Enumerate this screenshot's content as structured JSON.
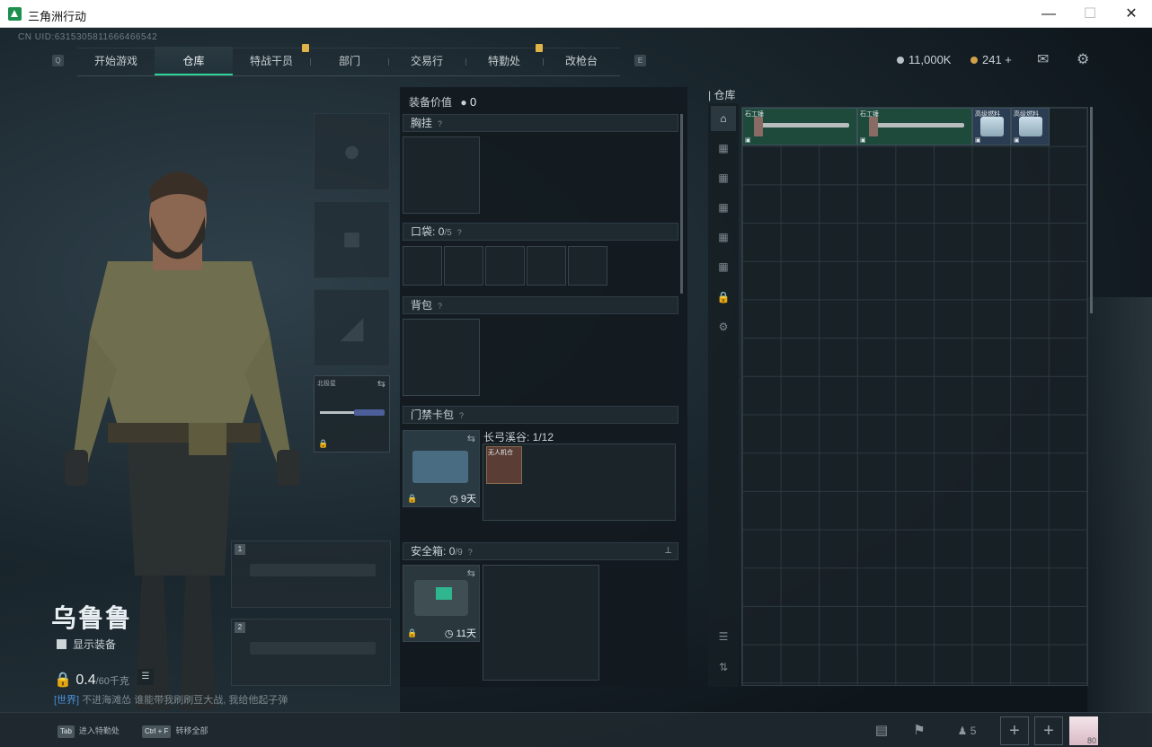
{
  "window": {
    "title": "三角洲行动"
  },
  "uid": "CN UID:6315305811666466542",
  "nav": {
    "left_key": "Q",
    "right_key": "E",
    "tabs": [
      {
        "label": "开始游戏"
      },
      {
        "label": "仓库",
        "active": true
      },
      {
        "label": "特战干员"
      },
      {
        "label": "部门"
      },
      {
        "label": "交易行"
      },
      {
        "label": "特勤处"
      },
      {
        "label": "改枪台"
      }
    ]
  },
  "currency": {
    "money": "11,000K",
    "coins": "241 +"
  },
  "character": {
    "name": "乌鲁鲁",
    "show_equipment_label": "显示装备",
    "weight_value": "0.4",
    "weight_max": "/60千克",
    "chat_channel": "[世界]",
    "chat_text": "不进海滩怂 谁能带我刷刷豆大战, 我给他起子弹"
  },
  "slots": {
    "melee_label": "北极星",
    "primary_1": "1",
    "primary_2": "2"
  },
  "loadout": {
    "value_label": "装备价值",
    "value": "0",
    "chest_rig": "胸挂",
    "pockets_label": "口袋:",
    "pockets_value": "0",
    "pockets_max": "/5",
    "backpack": "背包",
    "keycase": "门禁卡包",
    "keycase_map": "长弓溪谷: 1/12",
    "keycase_days": "9天",
    "key_item_label": "无人机仓",
    "safebox_label": "安全箱:",
    "safebox_value": "0",
    "safebox_max": "/9",
    "safebox_days": "11天"
  },
  "warehouse": {
    "title": "仓库",
    "items": [
      {
        "label": "石工锤",
        "kind": "hammer"
      },
      {
        "label": "石工锤",
        "kind": "hammer"
      },
      {
        "label": "高级燃料",
        "kind": "can"
      },
      {
        "label": "高级燃料",
        "kind": "can"
      }
    ]
  },
  "bottom": {
    "hint1_key": "Tab",
    "hint1": "进入特勤处",
    "hint2_key": "Ctrl + F",
    "hint2": "转移全部",
    "friends_count": "5",
    "level": "80"
  },
  "colors": {
    "accent": "#2fd29a",
    "badge": "#e0b347",
    "chat_channel": "#4b8fd6"
  },
  "icons": [
    "mail-icon",
    "settings-icon",
    "swap-icon",
    "lock-icon",
    "clock-icon",
    "pin-icon",
    "stats-icon",
    "flag-icon",
    "friends-icon",
    "plus-icon"
  ]
}
